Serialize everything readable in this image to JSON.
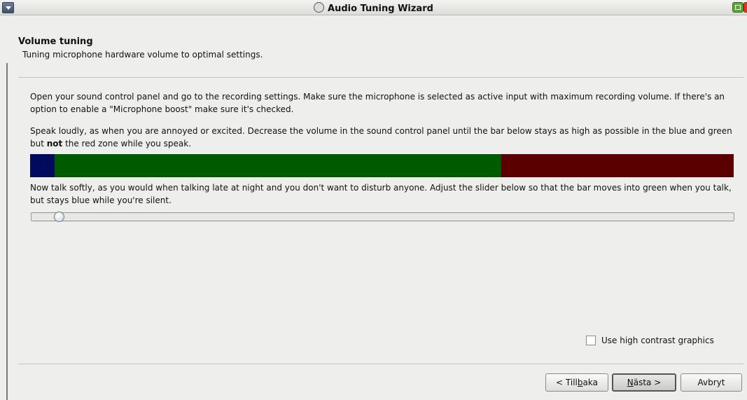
{
  "window": {
    "title": "Audio Tuning Wizard"
  },
  "header": {
    "title": "Volume tuning",
    "subtitle": "Tuning microphone hardware volume to optimal settings."
  },
  "instructions": {
    "p1": "Open your sound control panel and go to the recording settings. Make sure the microphone is selected as active input with maximum recording volume. If there's an option to enable a \"Microphone boost\" make sure it's checked.",
    "p2_before": "Speak loudly, as when you are annoyed or excited. Decrease the volume in the sound control panel until the bar below stays as high as possible in the blue and green but ",
    "p2_bold": "not",
    "p2_after": " the red zone while you speak.",
    "p3": "Now talk softly, as you would when talking late at night and you don't want to disturb anyone. Adjust the slider below so that the bar moves into green when you talk, but stays blue while you're silent."
  },
  "meter": {
    "zones": [
      {
        "name": "blue",
        "color": "#000b5e",
        "fraction": 0.035
      },
      {
        "name": "green",
        "color": "#005a00",
        "fraction": 0.635
      },
      {
        "name": "red",
        "color": "#5a0000",
        "fraction": 0.33
      }
    ]
  },
  "slider": {
    "value_fraction": 0.04
  },
  "options": {
    "high_contrast_label": "Use high contrast graphics",
    "high_contrast_checked": false
  },
  "buttons": {
    "back_pre": "< Till",
    "back_mn": "b",
    "back_post": "aka",
    "next_pre": "",
    "next_mn": "N",
    "next_post": "ästa >",
    "cancel": "Avbryt"
  }
}
